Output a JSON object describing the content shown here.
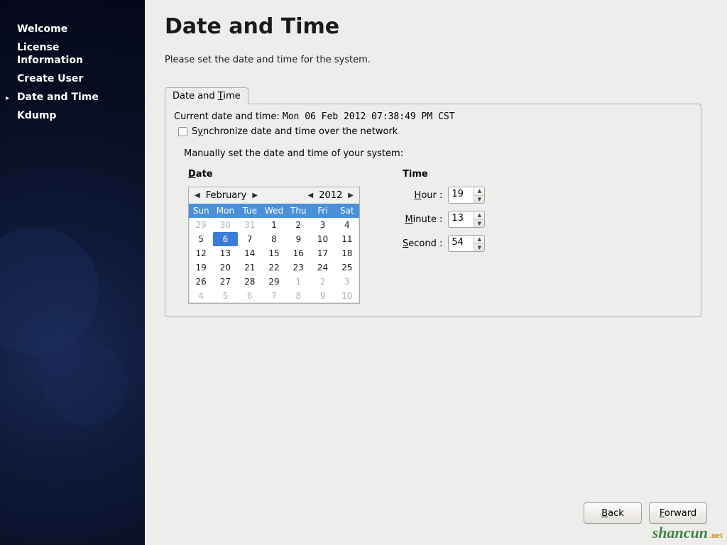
{
  "sidebar": {
    "items": [
      {
        "label": "Welcome",
        "current": false
      },
      {
        "label": "License\nInformation",
        "current": false
      },
      {
        "label": "Create User",
        "current": false
      },
      {
        "label": "Date and Time",
        "current": true
      },
      {
        "label": "Kdump",
        "current": false
      }
    ]
  },
  "page": {
    "title": "Date and Time",
    "subtitle": "Please set the date and time for the system.",
    "tab_label_pre": "Date and ",
    "tab_label_ul": "T",
    "tab_label_post": "ime",
    "current_label": "Current date and time:",
    "current_value": "Mon 06 Feb 2012 07:38:49 PM CST",
    "sync_pre": "S",
    "sync_ul": "y",
    "sync_post": "nchronize date and time over the network",
    "manual_label": "Manually set the date and time of your system:",
    "date_heading_ul": "D",
    "date_heading_post": "ate",
    "time_heading": "Time"
  },
  "calendar": {
    "month": "February",
    "year": "2012",
    "dow": [
      "Sun",
      "Mon",
      "Tue",
      "Wed",
      "Thu",
      "Fri",
      "Sat"
    ],
    "cells": [
      {
        "n": "29",
        "other": true
      },
      {
        "n": "30",
        "other": true
      },
      {
        "n": "31",
        "other": true
      },
      {
        "n": "1"
      },
      {
        "n": "2"
      },
      {
        "n": "3"
      },
      {
        "n": "4"
      },
      {
        "n": "5"
      },
      {
        "n": "6",
        "selected": true
      },
      {
        "n": "7"
      },
      {
        "n": "8"
      },
      {
        "n": "9"
      },
      {
        "n": "10"
      },
      {
        "n": "11"
      },
      {
        "n": "12"
      },
      {
        "n": "13"
      },
      {
        "n": "14"
      },
      {
        "n": "15"
      },
      {
        "n": "16"
      },
      {
        "n": "17"
      },
      {
        "n": "18"
      },
      {
        "n": "19"
      },
      {
        "n": "20"
      },
      {
        "n": "21"
      },
      {
        "n": "22"
      },
      {
        "n": "23"
      },
      {
        "n": "24"
      },
      {
        "n": "25"
      },
      {
        "n": "26"
      },
      {
        "n": "27"
      },
      {
        "n": "28"
      },
      {
        "n": "29"
      },
      {
        "n": "1",
        "other": true
      },
      {
        "n": "2",
        "other": true
      },
      {
        "n": "3",
        "other": true
      },
      {
        "n": "4",
        "other": true
      },
      {
        "n": "5",
        "other": true
      },
      {
        "n": "6",
        "other": true
      },
      {
        "n": "7",
        "other": true
      },
      {
        "n": "8",
        "other": true
      },
      {
        "n": "9",
        "other": true
      },
      {
        "n": "10",
        "other": true
      }
    ]
  },
  "time": {
    "hour_label_ul": "H",
    "hour_label_post": "our :",
    "hour_value": "19",
    "minute_label_ul": "M",
    "minute_label_post": "inute :",
    "minute_value": "13",
    "second_label_ul": "S",
    "second_label_post": "econd :",
    "second_value": "54"
  },
  "footer": {
    "back_ul": "B",
    "back_post": "ack",
    "forward_ul": "F",
    "forward_post": "orward"
  },
  "watermark": {
    "text": "shancun",
    "suffix": ".net"
  }
}
